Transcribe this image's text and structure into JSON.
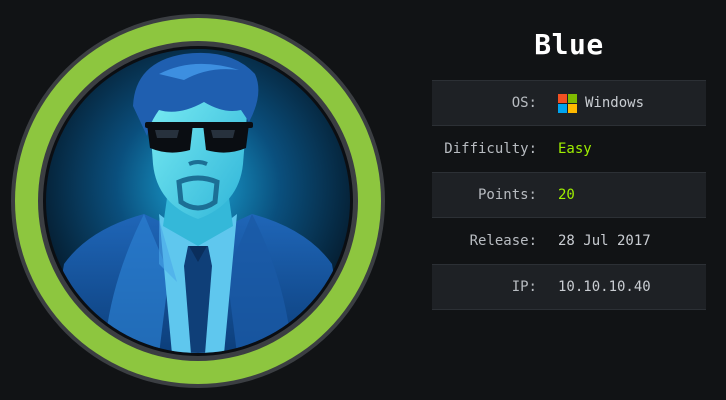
{
  "machine": {
    "name": "Blue",
    "rows": [
      {
        "label": "OS:",
        "value": "Windows",
        "icon": "windows-logo-icon",
        "color": "#c9cdd2"
      },
      {
        "label": "Difficulty:",
        "value": "Easy",
        "color": "#9fef00"
      },
      {
        "label": "Points:",
        "value": "20",
        "color": "#9fef00"
      },
      {
        "label": "Release:",
        "value": "28 Jul 2017",
        "color": "#c9cdd2"
      },
      {
        "label": "IP:",
        "value": "10.10.10.40",
        "color": "#c9cdd2"
      }
    ]
  },
  "colors": {
    "ring": "#8dc63f",
    "accent_green": "#9fef00",
    "background": "#111315",
    "row_shade": "#1e2125"
  },
  "avatar": {
    "icon": "agent-avatar-icon"
  }
}
